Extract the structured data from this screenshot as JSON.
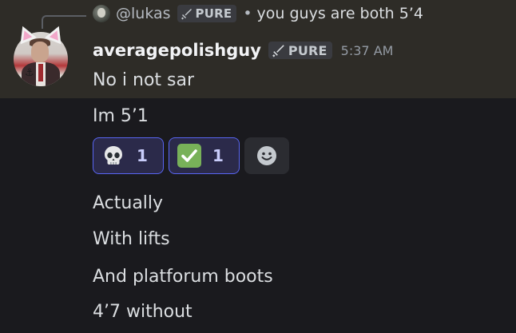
{
  "reply": {
    "username": "@lukas",
    "tag": "PURE",
    "separator": "•",
    "text": "you guys are both 5’4"
  },
  "message": {
    "username": "averagepolishguy",
    "tag": "PURE",
    "timestamp": "5:37 AM"
  },
  "lines": [
    "No i not sar",
    "Im 5’1",
    "Actually",
    "With lifts",
    "And platforum boots",
    "4’7 without"
  ],
  "reactions": [
    {
      "emoji": "skull-emoji",
      "count": "1"
    },
    {
      "emoji": "white-check-mark-emoji",
      "count": "1"
    }
  ],
  "colors": {
    "background": "#1a1a1e",
    "highlight": "#2e2c27",
    "reaction_active_border": "#5865f2",
    "reaction_active_bg": "#2b2a4a",
    "check_green": "#78b159"
  }
}
